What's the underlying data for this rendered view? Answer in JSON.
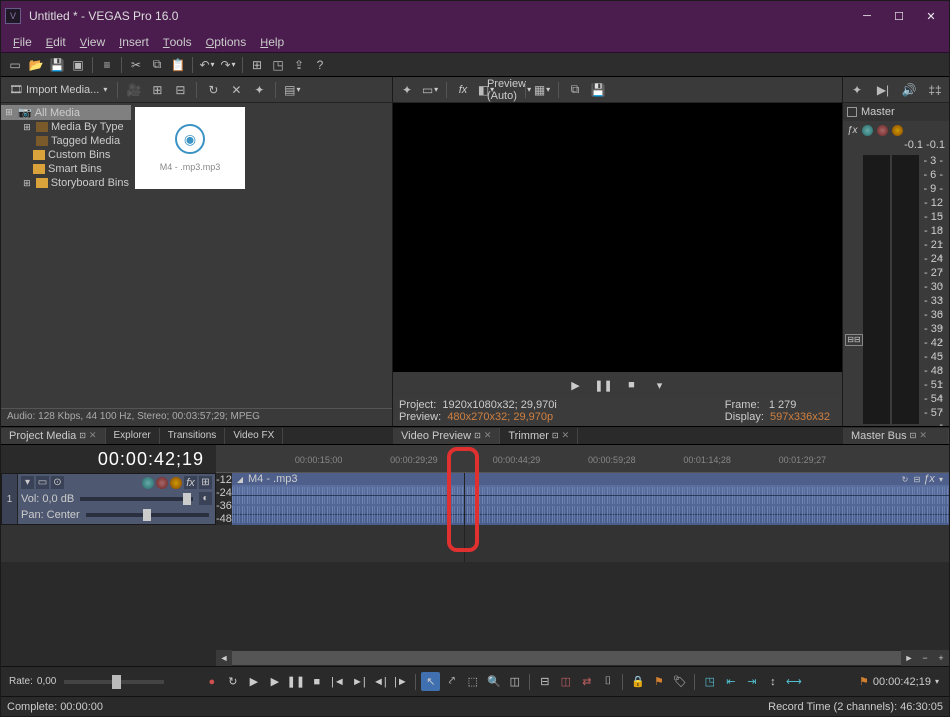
{
  "window": {
    "title": "Untitled * - VEGAS Pro 16.0",
    "icon_letter": "V"
  },
  "menu": {
    "file": "File",
    "edit": "Edit",
    "view": "View",
    "insert": "Insert",
    "tools": "Tools",
    "options": "Options",
    "help": "Help"
  },
  "media": {
    "import_label": "Import Media...",
    "tree": {
      "all": "All Media",
      "by_type": "Media By Type",
      "tagged": "Tagged Media",
      "custom": "Custom Bins",
      "smart": "Smart Bins",
      "storyboard": "Storyboard Bins"
    },
    "thumb_name": "M4 -   .mp3.mp3",
    "status": "Audio: 128 Kbps, 44 100 Hz, Stereo; 00:03:57;29; MPEG"
  },
  "preview": {
    "quality_label": "Preview (Auto)",
    "info": {
      "project_label": "Project:",
      "project_value": "1920x1080x32; 29,970i",
      "preview_label": "Preview:",
      "preview_value": "480x270x32; 29,970p",
      "frame_label": "Frame:",
      "frame_value": "1 279",
      "display_label": "Display:",
      "display_value": "597x336x32"
    }
  },
  "master": {
    "label": "Master",
    "top_left": "-0.1",
    "top_right": "-0.1",
    "scale": [
      "- 3 -",
      "- 6 -",
      "- 9 -",
      "- 12 -",
      "- 15 -",
      "- 18 -",
      "- 21 -",
      "- 24 -",
      "- 27 -",
      "- 30 -",
      "- 33 -",
      "- 36 -",
      "- 39 -",
      "- 42 -",
      "- 45 -",
      "- 48 -",
      "- 51 -",
      "- 54 -",
      "- 57 -"
    ]
  },
  "tabs": {
    "project_media": "Project Media",
    "explorer": "Explorer",
    "transitions": "Transitions",
    "video_fx": "Video FX",
    "video_preview": "Video Preview",
    "trimmer": "Trimmer",
    "master_bus": "Master Bus"
  },
  "timeline": {
    "timecode": "00:00:42;19",
    "ruler": [
      "00:00:15;00",
      "00:00:29;29",
      "00:00:44;29",
      "00:00:59;28",
      "00:01:14;28",
      "00:01:29;27"
    ],
    "track": {
      "number": "1",
      "vol_label": "Vol:",
      "vol_value": "0,0 dB",
      "pan_label": "Pan:",
      "pan_value": "Center"
    },
    "db": [
      "-12-",
      "-24-",
      "-36-",
      "-48-"
    ],
    "clip_name": "M4 -   .mp3",
    "fx_suffix": "ƒx"
  },
  "transport": {
    "rate_label": "Rate:",
    "rate_value": "0,00",
    "timecode": "00:00:42;19"
  },
  "status": {
    "left": "Complete: 00:00:00",
    "right": "Record Time (2 channels): 46:30:05"
  }
}
